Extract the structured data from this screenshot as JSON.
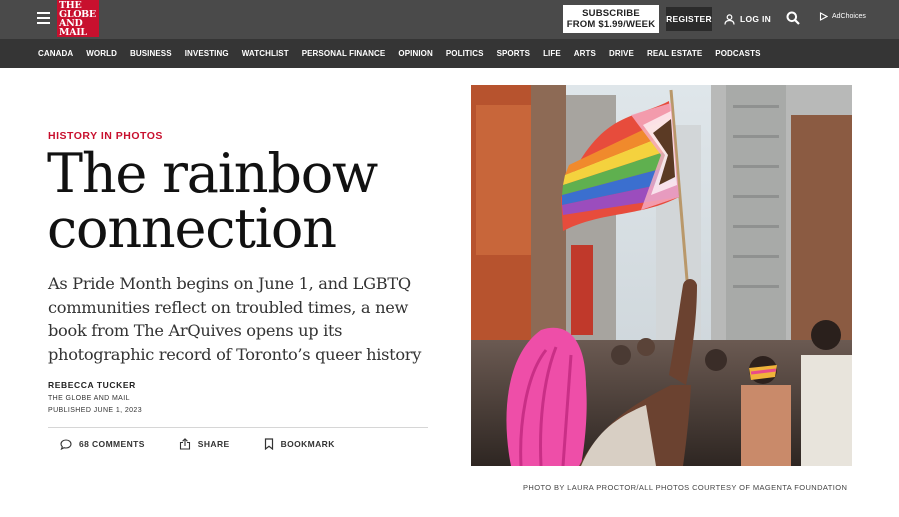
{
  "header": {
    "logo_lines": [
      "THE",
      "GLOBE",
      "AND",
      "MAIL"
    ],
    "subscribe_line1": "SUBSCRIBE",
    "subscribe_line2": "FROM $1.99/WEEK",
    "register_label": "REGISTER",
    "login_label": "LOG IN",
    "adchoices_label": "AdChoices",
    "brand_color": "#c8102e"
  },
  "nav": {
    "items": [
      "CANADA",
      "WORLD",
      "BUSINESS",
      "INVESTING",
      "WATCHLIST",
      "PERSONAL FINANCE",
      "OPINION",
      "POLITICS",
      "SPORTS",
      "LIFE",
      "ARTS",
      "DRIVE",
      "REAL ESTATE",
      "PODCASTS"
    ]
  },
  "article": {
    "kicker": "HISTORY IN PHOTOS",
    "headline_line1": "The rainbow",
    "headline_line2": "connection",
    "dek": "As Pride Month begins on June 1, and LGBTQ communities reflect on troubled times, a new book from The ArQuives opens up its photographic record of Toronto’s queer history",
    "author": "REBECCA TUCKER",
    "source": "THE GLOBE AND MAIL",
    "published": "PUBLISHED JUNE 1, 2023",
    "actions": {
      "comments": "68 COMMENTS",
      "share": "SHARE",
      "bookmark": "BOOKMARK"
    },
    "photo_caption": "PHOTO BY LAURA PROCTOR/ALL PHOTOS COURTESY OF MAGENTA FOUNDATION"
  }
}
